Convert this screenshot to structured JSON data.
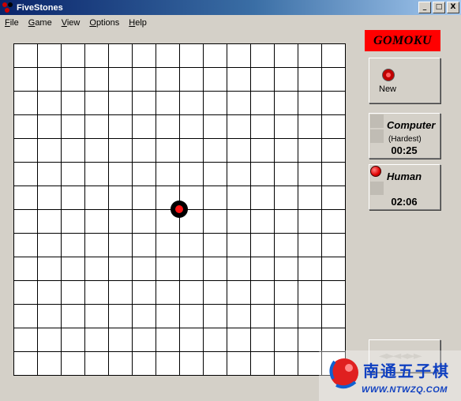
{
  "window": {
    "title": "FiveStones",
    "buttons": [
      "_",
      "□",
      "X"
    ]
  },
  "menu": {
    "items": [
      {
        "label": "File",
        "underline": "F",
        "rest": "ile"
      },
      {
        "label": "Game",
        "underline": "G",
        "rest": "ame"
      },
      {
        "label": "View",
        "underline": "V",
        "rest": "iew"
      },
      {
        "label": "Options",
        "underline": "O",
        "rest": "ptions"
      },
      {
        "label": "Help",
        "underline": "H",
        "rest": "elp"
      }
    ]
  },
  "board": {
    "columns": 14,
    "rows": 14,
    "stones": [
      {
        "col": 7,
        "row": 7,
        "color": "black-red"
      }
    ]
  },
  "sidebar": {
    "logo": "GOMOKU",
    "new_button": {
      "label": "New",
      "icon": "new-game-icon"
    },
    "computer": {
      "name": "Computer",
      "level": "(Hardest)",
      "time": "00:25"
    },
    "human": {
      "name": "Human",
      "time": "02:06",
      "active": true
    },
    "nav": {
      "arrows": "◄►◄◄►►"
    }
  },
  "watermark": {
    "chars": "南通五子棋",
    "url": "WWW.NTWZQ.COM"
  },
  "colors": {
    "titlebar_start": "#0a246a",
    "logo_bg": "#ff0000",
    "stone_center": "#ff1414",
    "watermark_text": "#1040c0"
  }
}
